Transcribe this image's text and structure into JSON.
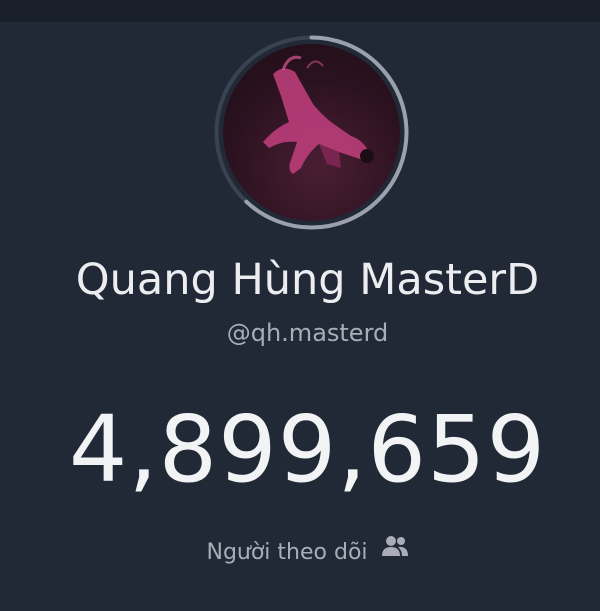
{
  "profile": {
    "display_name": "Quang Hùng MasterD",
    "handle": "@qh.masterd",
    "avatar_icon": "profile-photo-dancer",
    "progress_fraction": 0.62
  },
  "stats": {
    "follower_count": "4,899,659",
    "follower_label": "Người theo dõi",
    "follower_icon": "people-icon"
  },
  "colors": {
    "background": "#222936",
    "ring_track": "#3a4150",
    "ring_progress": "#9aa1ad",
    "primary_text": "#ecedf1",
    "secondary_text": "#a8adb8"
  }
}
